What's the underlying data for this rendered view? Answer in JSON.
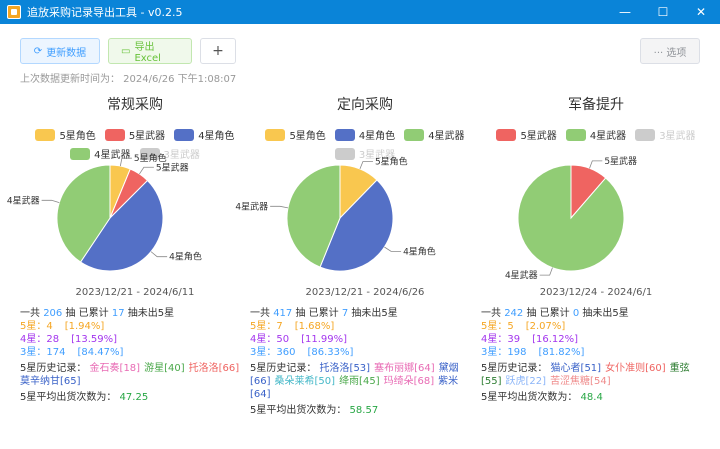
{
  "window": {
    "title": "追放采购记录导出工具 - v0.2.5",
    "controls": {
      "minimize": "—",
      "maximize": "☐",
      "close": "✕"
    }
  },
  "toolbar": {
    "refresh_label": "更新数据",
    "export_label": "导出Excel",
    "add_label": "+",
    "options_label": "··· 选项"
  },
  "last_update": "上次数据更新时间为：  2024/6/26 下午1:08:07",
  "legend_colors": {
    "5星角色": "#f9c74f",
    "5星武器": "#ef6461",
    "4星角色": "#5470c6",
    "4星武器": "#91cc75",
    "3星武器": "#cccccc"
  },
  "columns": [
    {
      "title": "常规采购",
      "legend": [
        {
          "label": "5星角色",
          "active": true
        },
        {
          "label": "5星武器",
          "active": true
        },
        {
          "label": "4星角色",
          "active": true
        },
        {
          "label": "4星武器",
          "active": true
        },
        {
          "label": "3星武器",
          "active": false
        }
      ],
      "slices": [
        {
          "label": "5星角色",
          "value": 2,
          "color": "#f9c74f"
        },
        {
          "label": "5星武器",
          "value": 2,
          "color": "#ef6461"
        },
        {
          "label": "4星角色",
          "value": 15,
          "color": "#5470c6"
        },
        {
          "label": "4星武器",
          "value": 13,
          "color": "#91cc75"
        }
      ],
      "date_range": "2023/12/21   -   2024/6/11",
      "summary": {
        "pre": "一共 ",
        "total": "206",
        "mid": " 抽 已累计 ",
        "pending": "17",
        "post": " 抽未出5星"
      },
      "rows": [
        {
          "label": "5星：4",
          "pct": "[1.94%]",
          "cls": "c5"
        },
        {
          "label": "4星：28",
          "pct": "[13.59%]",
          "cls": "c4"
        },
        {
          "label": "3星：174",
          "pct": "[84.47%]",
          "cls": "c3"
        }
      ],
      "history_label": "5星历史记录：",
      "history": [
        {
          "text": "金石奏[18]",
          "color": "#e86bb4"
        },
        {
          "text": "游星[40]",
          "color": "#4aa84a"
        },
        {
          "text": "托洛洛[66]",
          "color": "#ef6461"
        },
        {
          "text": "莫辛纳甘[65]",
          "color": "#3a62c8"
        }
      ],
      "avg_label": "5星平均出货次数为：",
      "avg_value": "47.25"
    },
    {
      "title": "定向采购",
      "legend": [
        {
          "label": "5星角色",
          "active": true
        },
        {
          "label": "4星角色",
          "active": true
        },
        {
          "label": "4星武器",
          "active": true
        },
        {
          "label": "3星武器",
          "active": false
        }
      ],
      "slices": [
        {
          "label": "5星角色",
          "value": 7,
          "color": "#f9c74f"
        },
        {
          "label": "4星角色",
          "value": 25,
          "color": "#5470c6"
        },
        {
          "label": "4星武器",
          "value": 25,
          "color": "#91cc75"
        }
      ],
      "date_range": "2023/12/21   -   2024/6/26",
      "summary": {
        "pre": "一共 ",
        "total": "417",
        "mid": " 抽 已累计 ",
        "pending": "7",
        "post": " 抽未出5星"
      },
      "rows": [
        {
          "label": "5星：7",
          "pct": "[1.68%]",
          "cls": "c5"
        },
        {
          "label": "4星：50",
          "pct": "[11.99%]",
          "cls": "c4"
        },
        {
          "label": "3星：360",
          "pct": "[86.33%]",
          "cls": "c3"
        }
      ],
      "history_label": "5星历史记录：",
      "history": [
        {
          "text": "托洛洛[53]",
          "color": "#3a62c8"
        },
        {
          "text": "塞布丽娜[64]",
          "color": "#e86bb4"
        },
        {
          "text": "黛烟[66]",
          "color": "#3a62c8"
        },
        {
          "text": "桑朵莱希[50]",
          "color": "#45b8c8"
        },
        {
          "text": "绛雨[45]",
          "color": "#4aa84a"
        },
        {
          "text": "玛绮朵[68]",
          "color": "#e86bb4"
        },
        {
          "text": "紫米[64]",
          "color": "#3a62c8"
        }
      ],
      "avg_label": "5星平均出货次数为：",
      "avg_value": "58.57"
    },
    {
      "title": "军备提升",
      "legend": [
        {
          "label": "5星武器",
          "active": true
        },
        {
          "label": "4星武器",
          "active": true
        },
        {
          "label": "3星武器",
          "active": false
        }
      ],
      "slices": [
        {
          "label": "5星武器",
          "value": 5,
          "color": "#ef6461"
        },
        {
          "label": "4星武器",
          "value": 39,
          "color": "#91cc75"
        }
      ],
      "date_range": "2023/12/24   -   2024/6/1",
      "summary": {
        "pre": "一共 ",
        "total": "242",
        "mid": " 抽 已累计 ",
        "pending": "0",
        "post": " 抽未出5星"
      },
      "rows": [
        {
          "label": "5星：5",
          "pct": "[2.07%]",
          "cls": "c5"
        },
        {
          "label": "4星：39",
          "pct": "[16.12%]",
          "cls": "c4"
        },
        {
          "label": "3星：198",
          "pct": "[81.82%]",
          "cls": "c3"
        }
      ],
      "history_label": "5星历史记录：",
      "history": [
        {
          "text": "猫心者[51]",
          "color": "#3a62c8"
        },
        {
          "text": "女仆准则[60]",
          "color": "#ef6461"
        },
        {
          "text": "重弦[55]",
          "color": "#2e7d32"
        },
        {
          "text": "跃虎[22]",
          "color": "#8ab4f8"
        },
        {
          "text": "苦涩焦糖[54]",
          "color": "#ef8a8a"
        }
      ],
      "avg_label": "5星平均出货次数为：",
      "avg_value": "48.4"
    }
  ]
}
